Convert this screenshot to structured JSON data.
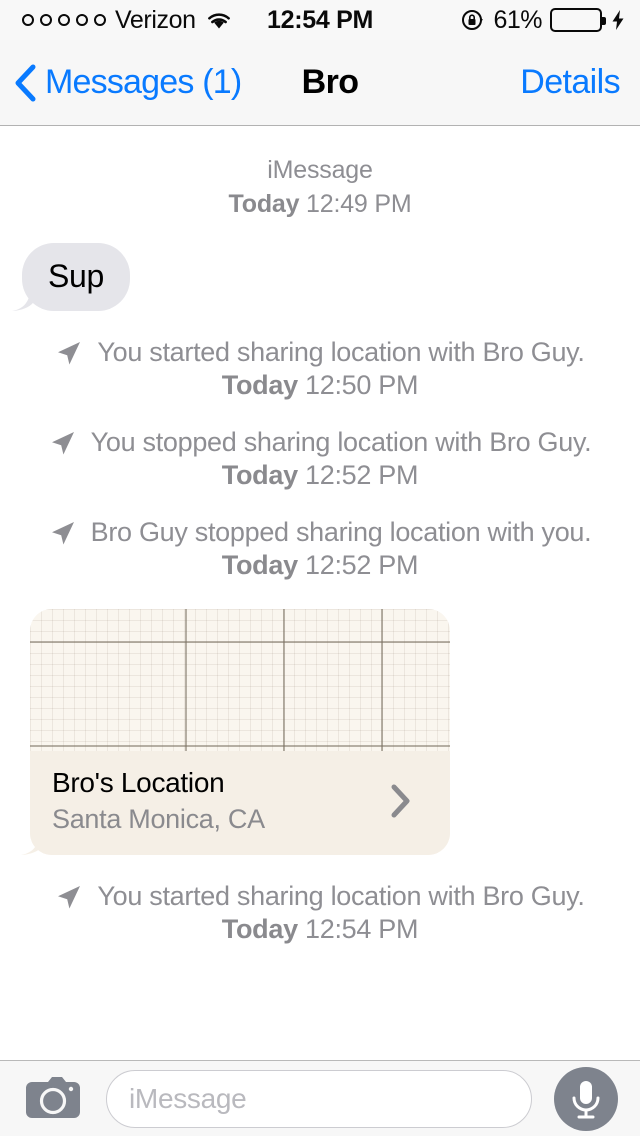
{
  "status_bar": {
    "signal_dots": 5,
    "signal_filled": 0,
    "carrier": "Verizon",
    "wifi_icon": "wifi-icon",
    "time": "12:54 PM",
    "rotation_lock_icon": "rotation-lock-icon",
    "battery_percent_label": "61%",
    "battery_level": 61,
    "battery_color": "#4cd964",
    "charging_icon": "lightning-bolt-icon"
  },
  "nav_bar": {
    "back_icon": "chevron-left-icon",
    "back_label": "Messages (1)",
    "title": "Bro",
    "details_label": "Details",
    "accent_color": "#097aff"
  },
  "thread": {
    "service_label": "iMessage",
    "service_day": "Today",
    "service_time": "12:49 PM",
    "bubbles": [
      {
        "type": "incoming",
        "text": "Sup",
        "bg": "#e5e5ea"
      }
    ],
    "location_events": [
      {
        "icon": "location-arrow-icon",
        "text": "You started sharing location with Bro Guy.",
        "day": "Today",
        "time": "12:50 PM"
      },
      {
        "icon": "location-arrow-icon",
        "text": "You stopped sharing location with Bro Guy.",
        "day": "Today",
        "time": "12:52 PM"
      },
      {
        "icon": "location-arrow-icon",
        "text": "Bro Guy stopped sharing location with you.",
        "day": "Today",
        "time": "12:52 PM"
      }
    ],
    "map_bubble": {
      "title": "Bro's Location",
      "subtitle": "Santa Monica, CA",
      "chevron_icon": "chevron-right-icon",
      "map_bg": "#faf6ef",
      "label_bg": "#f5efe6"
    },
    "location_events_after": [
      {
        "icon": "location-arrow-icon",
        "text": "You started sharing location with Bro Guy.",
        "day": "Today",
        "time": "12:54 PM"
      }
    ]
  },
  "toolbar": {
    "camera_icon": "camera-icon",
    "input_value": "",
    "input_placeholder": "iMessage",
    "mic_icon": "microphone-icon"
  }
}
